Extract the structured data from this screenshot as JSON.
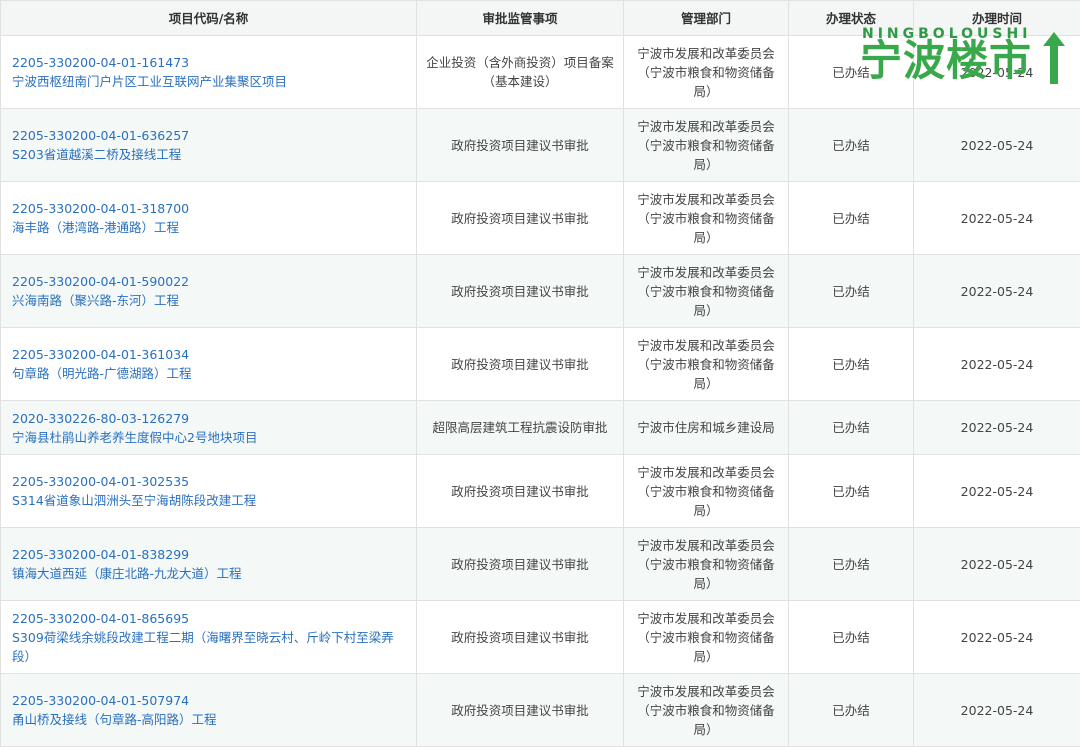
{
  "table": {
    "headers": [
      "项目代码/名称",
      "审批监管事项",
      "管理部门",
      "办理状态",
      "办理时间"
    ],
    "rows": [
      {
        "code": "2205-330200-04-01-161473",
        "name": "宁波西枢纽南门户片区工业互联网产业集聚区项目",
        "item": "企业投资（含外商投资）项目备案（基本建设）",
        "dept": "宁波市发展和改革委员会（宁波市粮食和物资储备局）",
        "status": "已办结",
        "date": "2022-05-24"
      },
      {
        "code": "2205-330200-04-01-636257",
        "name": "S203省道越溪二桥及接线工程",
        "item": "政府投资项目建议书审批",
        "dept": "宁波市发展和改革委员会（宁波市粮食和物资储备局）",
        "status": "已办结",
        "date": "2022-05-24"
      },
      {
        "code": "2205-330200-04-01-318700",
        "name": "海丰路（港湾路-港通路）工程",
        "item": "政府投资项目建议书审批",
        "dept": "宁波市发展和改革委员会（宁波市粮食和物资储备局）",
        "status": "已办结",
        "date": "2022-05-24"
      },
      {
        "code": "2205-330200-04-01-590022",
        "name": "兴海南路（聚兴路-东河）工程",
        "item": "政府投资项目建议书审批",
        "dept": "宁波市发展和改革委员会（宁波市粮食和物资储备局）",
        "status": "已办结",
        "date": "2022-05-24"
      },
      {
        "code": "2205-330200-04-01-361034",
        "name": "句章路（明光路-广德湖路）工程",
        "item": "政府投资项目建议书审批",
        "dept": "宁波市发展和改革委员会（宁波市粮食和物资储备局）",
        "status": "已办结",
        "date": "2022-05-24"
      },
      {
        "code": "2020-330226-80-03-126279",
        "name": "宁海县杜鹃山养老养生度假中心2号地块项目",
        "item": "超限高层建筑工程抗震设防审批",
        "dept": "宁波市住房和城乡建设局",
        "status": "已办结",
        "date": "2022-05-24"
      },
      {
        "code": "2205-330200-04-01-302535",
        "name": "S314省道象山泗洲头至宁海胡陈段改建工程",
        "item": "政府投资项目建议书审批",
        "dept": "宁波市发展和改革委员会（宁波市粮食和物资储备局）",
        "status": "已办结",
        "date": "2022-05-24"
      },
      {
        "code": "2205-330200-04-01-838299",
        "name": "镇海大道西延（康庄北路-九龙大道）工程",
        "item": "政府投资项目建议书审批",
        "dept": "宁波市发展和改革委员会（宁波市粮食和物资储备局）",
        "status": "已办结",
        "date": "2022-05-24"
      },
      {
        "code": "2205-330200-04-01-865695",
        "name": "S309荷梁线余姚段改建工程二期（海曙界至晓云村、斤岭下村至梁弄段）",
        "item": "政府投资项目建议书审批",
        "dept": "宁波市发展和改革委员会（宁波市粮食和物资储备局）",
        "status": "已办结",
        "date": "2022-05-24"
      },
      {
        "code": "2205-330200-04-01-507974",
        "name": "甬山桥及接线（句章路-高阳路）工程",
        "item": "政府投资项目建议书审批",
        "dept": "宁波市发展和改革委员会（宁波市粮食和物资储备局）",
        "status": "已办结",
        "date": "2022-05-24"
      }
    ]
  },
  "watermark": {
    "sub": "NINGBOLOUSHI",
    "main": "宁波楼市",
    "color": "#38a84b"
  },
  "colors": {
    "link": "#2a70c0",
    "header_bg": "#f4f6f5",
    "stripe_bg": "#f4f8f6",
    "border": "#e1e1e1"
  }
}
